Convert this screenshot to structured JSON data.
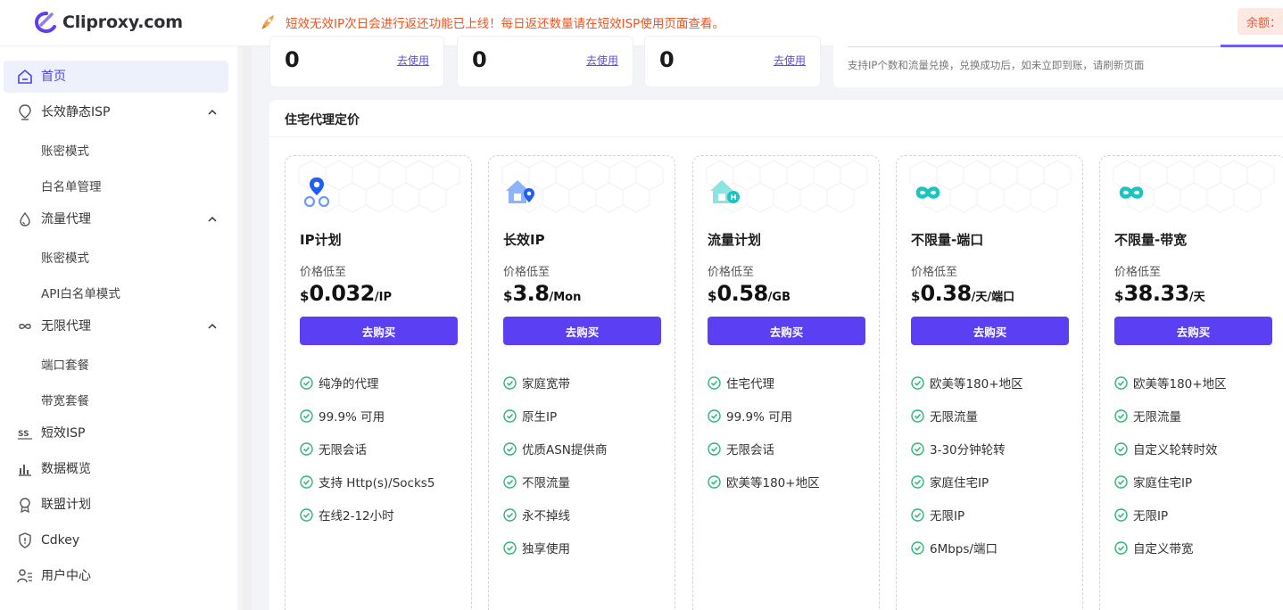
{
  "header": {
    "logo_text": "Cliproxy.com",
    "notice": "短效无效IP次日会进行返还功能已上线！每日返还数量请在短效ISP使用页面查看。",
    "balance_label": "余额："
  },
  "colors": {
    "accent": "#5b3ff3",
    "notice": "#f2531f",
    "check": "#2bb673"
  },
  "sidebar": {
    "items": [
      {
        "label": "首页",
        "icon": "home-icon"
      },
      {
        "label": "长效静态ISP",
        "icon": "location-pin-icon"
      },
      {
        "label": "账密模式"
      },
      {
        "label": "白名单管理"
      },
      {
        "label": "流量代理",
        "icon": "droplet-icon"
      },
      {
        "label": "账密模式"
      },
      {
        "label": "API白名单模式"
      },
      {
        "label": "无限代理",
        "icon": "infinity-icon"
      },
      {
        "label": "端口套餐"
      },
      {
        "label": "带宽套餐"
      },
      {
        "label": "短效ISP",
        "icon": "ss-icon"
      },
      {
        "label": "数据概览",
        "icon": "bar-chart-icon"
      },
      {
        "label": "联盟计划",
        "icon": "badge-icon"
      },
      {
        "label": "Cdkey",
        "icon": "shield-icon"
      },
      {
        "label": "用户中心",
        "icon": "user-list-icon"
      }
    ]
  },
  "top_cards": [
    {
      "value": "0",
      "link": "去使用"
    },
    {
      "value": "0",
      "link": "去使用"
    },
    {
      "value": "0",
      "link": "去使用"
    }
  ],
  "exchange": {
    "note": "支持IP个数和流量兑换，兑换成功后，如未立即到账，请刷新页面"
  },
  "pricing": {
    "title": "住宅代理定价",
    "price_from": "价格低至",
    "buy_label": "去购买",
    "currency": "$",
    "plans": [
      {
        "name": "IP计划",
        "price": "0.032",
        "unit": "/IP",
        "icon": "ip-pins-icon",
        "features": [
          "纯净的代理",
          "99.9% 可用",
          "无限会话",
          "支持 Http(s)/Socks5",
          "在线2-12小时"
        ]
      },
      {
        "name": "长效IP",
        "price": "3.8",
        "unit": "/Mon",
        "icon": "house-pin-icon",
        "features": [
          "家庭宽带",
          "原生IP",
          "优质ASN提供商",
          "不限流量",
          "永不掉线",
          "独享使用"
        ]
      },
      {
        "name": "流量计划",
        "price": "0.58",
        "unit": "/GB",
        "icon": "house-traffic-icon",
        "features": [
          "住宅代理",
          "99.9% 可用",
          "无限会话",
          "欧美等180+地区"
        ]
      },
      {
        "name": "不限量-端口",
        "price": "0.38",
        "unit": "/天/端口",
        "icon": "infinity-icon",
        "features": [
          "欧美等180+地区",
          "无限流量",
          "3-30分钟轮转",
          "家庭住宅IP",
          "无限IP",
          "6Mbps/端口"
        ]
      },
      {
        "name": "不限量-带宽",
        "price": "38.33",
        "unit": "/天",
        "icon": "infinity-icon",
        "features": [
          "欧美等180+地区",
          "无限流量",
          "自定义轮转时效",
          "家庭住宅IP",
          "无限IP",
          "自定义带宽"
        ]
      }
    ]
  }
}
